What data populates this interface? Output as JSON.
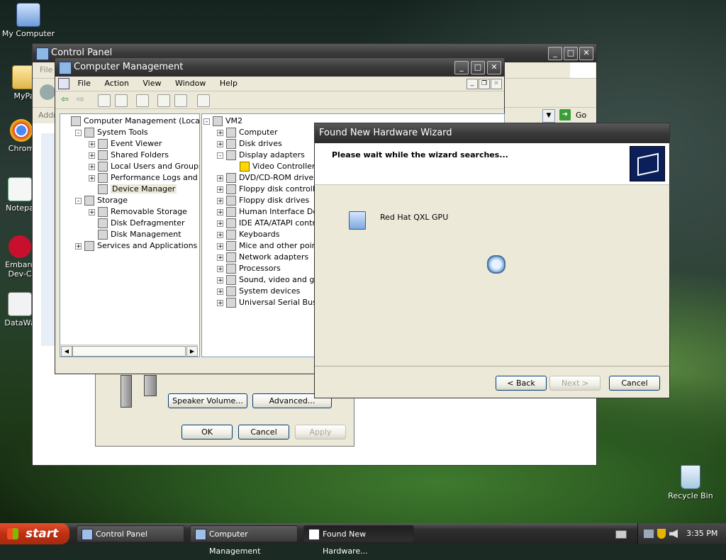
{
  "desktop": {
    "icons": [
      {
        "label": "My Computer"
      },
      {
        "label": "MyPa"
      },
      {
        "label": "Chrom"
      },
      {
        "label": "Notepa"
      },
      {
        "label": "Embarc Dev-C"
      },
      {
        "label": "DataWa"
      },
      {
        "label": "Recycle Bin"
      }
    ]
  },
  "control_panel": {
    "title": "Control Panel",
    "menu_file": "File",
    "address_label": "Addr",
    "go_label": "Go",
    "speaker_volume_button": "Speaker Volume...",
    "advanced_button": "Advanced...",
    "ok_button": "OK",
    "cancel_button": "Cancel",
    "apply_button": "Apply"
  },
  "computer_management": {
    "title": "Computer Management",
    "menu": [
      "File",
      "Action",
      "View",
      "Window",
      "Help"
    ],
    "tree": [
      {
        "label": "Computer Management (Local)",
        "level": 0,
        "expander": ""
      },
      {
        "label": "System Tools",
        "level": 1,
        "expander": "-"
      },
      {
        "label": "Event Viewer",
        "level": 2,
        "expander": "+"
      },
      {
        "label": "Shared Folders",
        "level": 2,
        "expander": "+"
      },
      {
        "label": "Local Users and Groups",
        "level": 2,
        "expander": "+"
      },
      {
        "label": "Performance Logs and Alerts",
        "level": 2,
        "expander": "+"
      },
      {
        "label": "Device Manager",
        "level": 2,
        "expander": "",
        "selected": true
      },
      {
        "label": "Storage",
        "level": 1,
        "expander": "-"
      },
      {
        "label": "Removable Storage",
        "level": 2,
        "expander": "+"
      },
      {
        "label": "Disk Defragmenter",
        "level": 2,
        "expander": ""
      },
      {
        "label": "Disk Management",
        "level": 2,
        "expander": ""
      },
      {
        "label": "Services and Applications",
        "level": 1,
        "expander": "+"
      }
    ],
    "devices": [
      {
        "label": "VM2",
        "level": 0,
        "expander": "-"
      },
      {
        "label": "Computer",
        "level": 1,
        "expander": "+"
      },
      {
        "label": "Disk drives",
        "level": 1,
        "expander": "+"
      },
      {
        "label": "Display adapters",
        "level": 1,
        "expander": "-"
      },
      {
        "label": "Video Controller",
        "level": 2,
        "expander": "",
        "warning": true
      },
      {
        "label": "DVD/CD-ROM drives",
        "level": 1,
        "expander": "+"
      },
      {
        "label": "Floppy disk controllers",
        "level": 1,
        "expander": "+"
      },
      {
        "label": "Floppy disk drives",
        "level": 1,
        "expander": "+"
      },
      {
        "label": "Human Interface Devices",
        "level": 1,
        "expander": "+"
      },
      {
        "label": "IDE ATA/ATAPI controllers",
        "level": 1,
        "expander": "+"
      },
      {
        "label": "Keyboards",
        "level": 1,
        "expander": "+"
      },
      {
        "label": "Mice and other pointing devices",
        "level": 1,
        "expander": "+"
      },
      {
        "label": "Network adapters",
        "level": 1,
        "expander": "+"
      },
      {
        "label": "Processors",
        "level": 1,
        "expander": "+"
      },
      {
        "label": "Sound, video and game controllers",
        "level": 1,
        "expander": "+"
      },
      {
        "label": "System devices",
        "level": 1,
        "expander": "+"
      },
      {
        "label": "Universal Serial Bus controllers",
        "level": 1,
        "expander": "+"
      }
    ]
  },
  "wizard": {
    "title": "Found New Hardware Wizard",
    "header": "Please wait while the wizard searches...",
    "device_name": "Red Hat QXL GPU",
    "back_button": "< Back",
    "next_button": "Next >",
    "cancel_button": "Cancel"
  },
  "taskbar": {
    "start_label": "start",
    "tasks": [
      {
        "label": "Control Panel",
        "active": false
      },
      {
        "label": "Computer Management",
        "active": false
      },
      {
        "label": "Found New Hardware...",
        "active": true
      }
    ],
    "clock": "3:35 PM"
  }
}
